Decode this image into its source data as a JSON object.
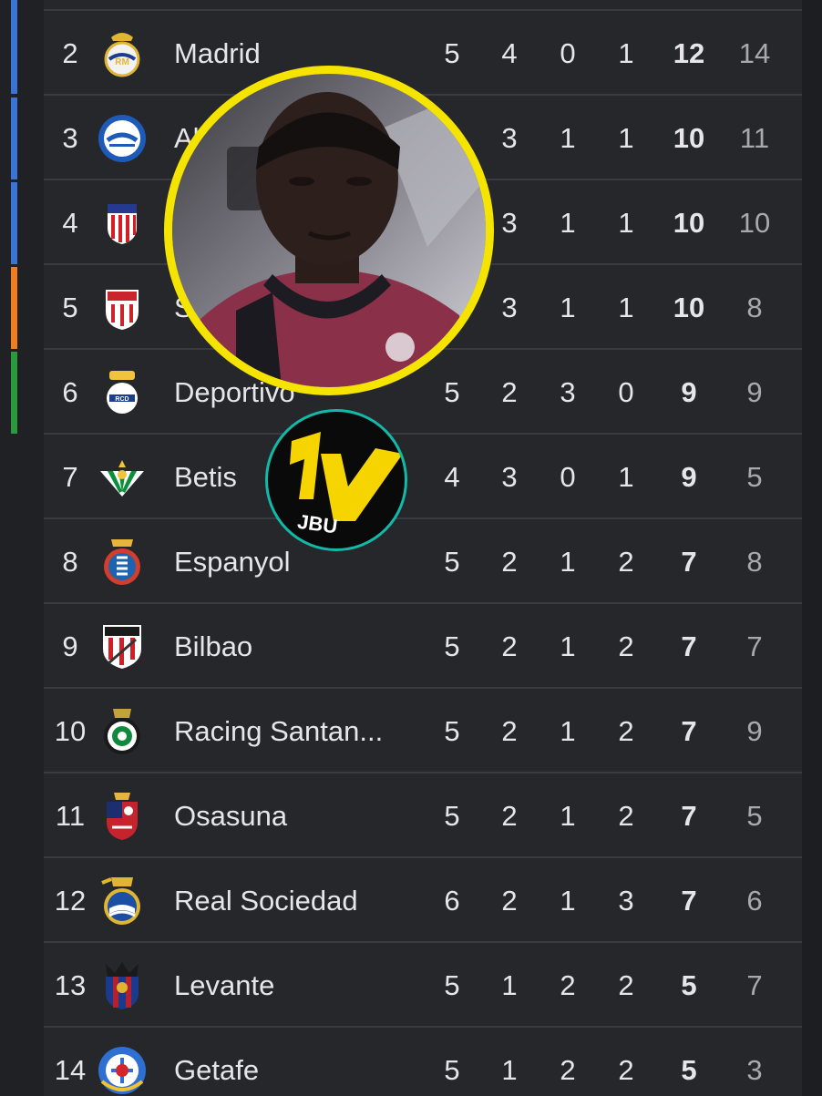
{
  "colors": {
    "zone_champions": "#3a74d6",
    "zone_europa": "#f07d1e",
    "zone_conference": "#2a9b3c",
    "accent_ring": "#f5e400",
    "logo_ring": "#12b9a8"
  },
  "standings": {
    "rows": [
      {
        "pos": "2",
        "team": "Madrid",
        "p": "5",
        "w": "4",
        "d": "0",
        "l": "1",
        "pts": "12",
        "gd": "14",
        "crest": "real-madrid-crest-icon"
      },
      {
        "pos": "3",
        "team": "Al",
        "p": "",
        "w": "3",
        "d": "1",
        "l": "1",
        "pts": "10",
        "gd": "11",
        "crest": "alaves-crest-icon"
      },
      {
        "pos": "4",
        "team": "",
        "p": "",
        "w": "3",
        "d": "1",
        "l": "1",
        "pts": "10",
        "gd": "10",
        "crest": "atletico-crest-icon"
      },
      {
        "pos": "5",
        "team": "S",
        "p": "",
        "w": "3",
        "d": "1",
        "l": "1",
        "pts": "10",
        "gd": "8",
        "crest": "sevilla-crest-icon"
      },
      {
        "pos": "6",
        "team": "Deportivo",
        "p": "5",
        "w": "2",
        "d": "3",
        "l": "0",
        "pts": "9",
        "gd": "9",
        "crest": "deportivo-crest-icon"
      },
      {
        "pos": "7",
        "team": "Betis",
        "p": "4",
        "w": "3",
        "d": "0",
        "l": "1",
        "pts": "9",
        "gd": "5",
        "crest": "betis-crest-icon"
      },
      {
        "pos": "8",
        "team": "Espanyol",
        "p": "5",
        "w": "2",
        "d": "1",
        "l": "2",
        "pts": "7",
        "gd": "8",
        "crest": "espanyol-crest-icon"
      },
      {
        "pos": "9",
        "team": "Bilbao",
        "p": "5",
        "w": "2",
        "d": "1",
        "l": "2",
        "pts": "7",
        "gd": "7",
        "crest": "bilbao-crest-icon"
      },
      {
        "pos": "10",
        "team": "Racing Santan...",
        "p": "5",
        "w": "2",
        "d": "1",
        "l": "2",
        "pts": "7",
        "gd": "9",
        "crest": "racing-crest-icon"
      },
      {
        "pos": "11",
        "team": "Osasuna",
        "p": "5",
        "w": "2",
        "d": "1",
        "l": "2",
        "pts": "7",
        "gd": "5",
        "crest": "osasuna-crest-icon"
      },
      {
        "pos": "12",
        "team": "Real Sociedad",
        "p": "6",
        "w": "2",
        "d": "1",
        "l": "3",
        "pts": "7",
        "gd": "6",
        "crest": "real-sociedad-crest-icon"
      },
      {
        "pos": "13",
        "team": "Levante",
        "p": "5",
        "w": "1",
        "d": "2",
        "l": "2",
        "pts": "5",
        "gd": "7",
        "crest": "levante-crest-icon"
      },
      {
        "pos": "14",
        "team": "Getafe",
        "p": "5",
        "w": "1",
        "d": "2",
        "l": "2",
        "pts": "5",
        "gd": "3",
        "crest": "getafe-crest-icon"
      }
    ]
  },
  "overlay": {
    "logo_text": "1V",
    "logo_sub": "JBU"
  }
}
